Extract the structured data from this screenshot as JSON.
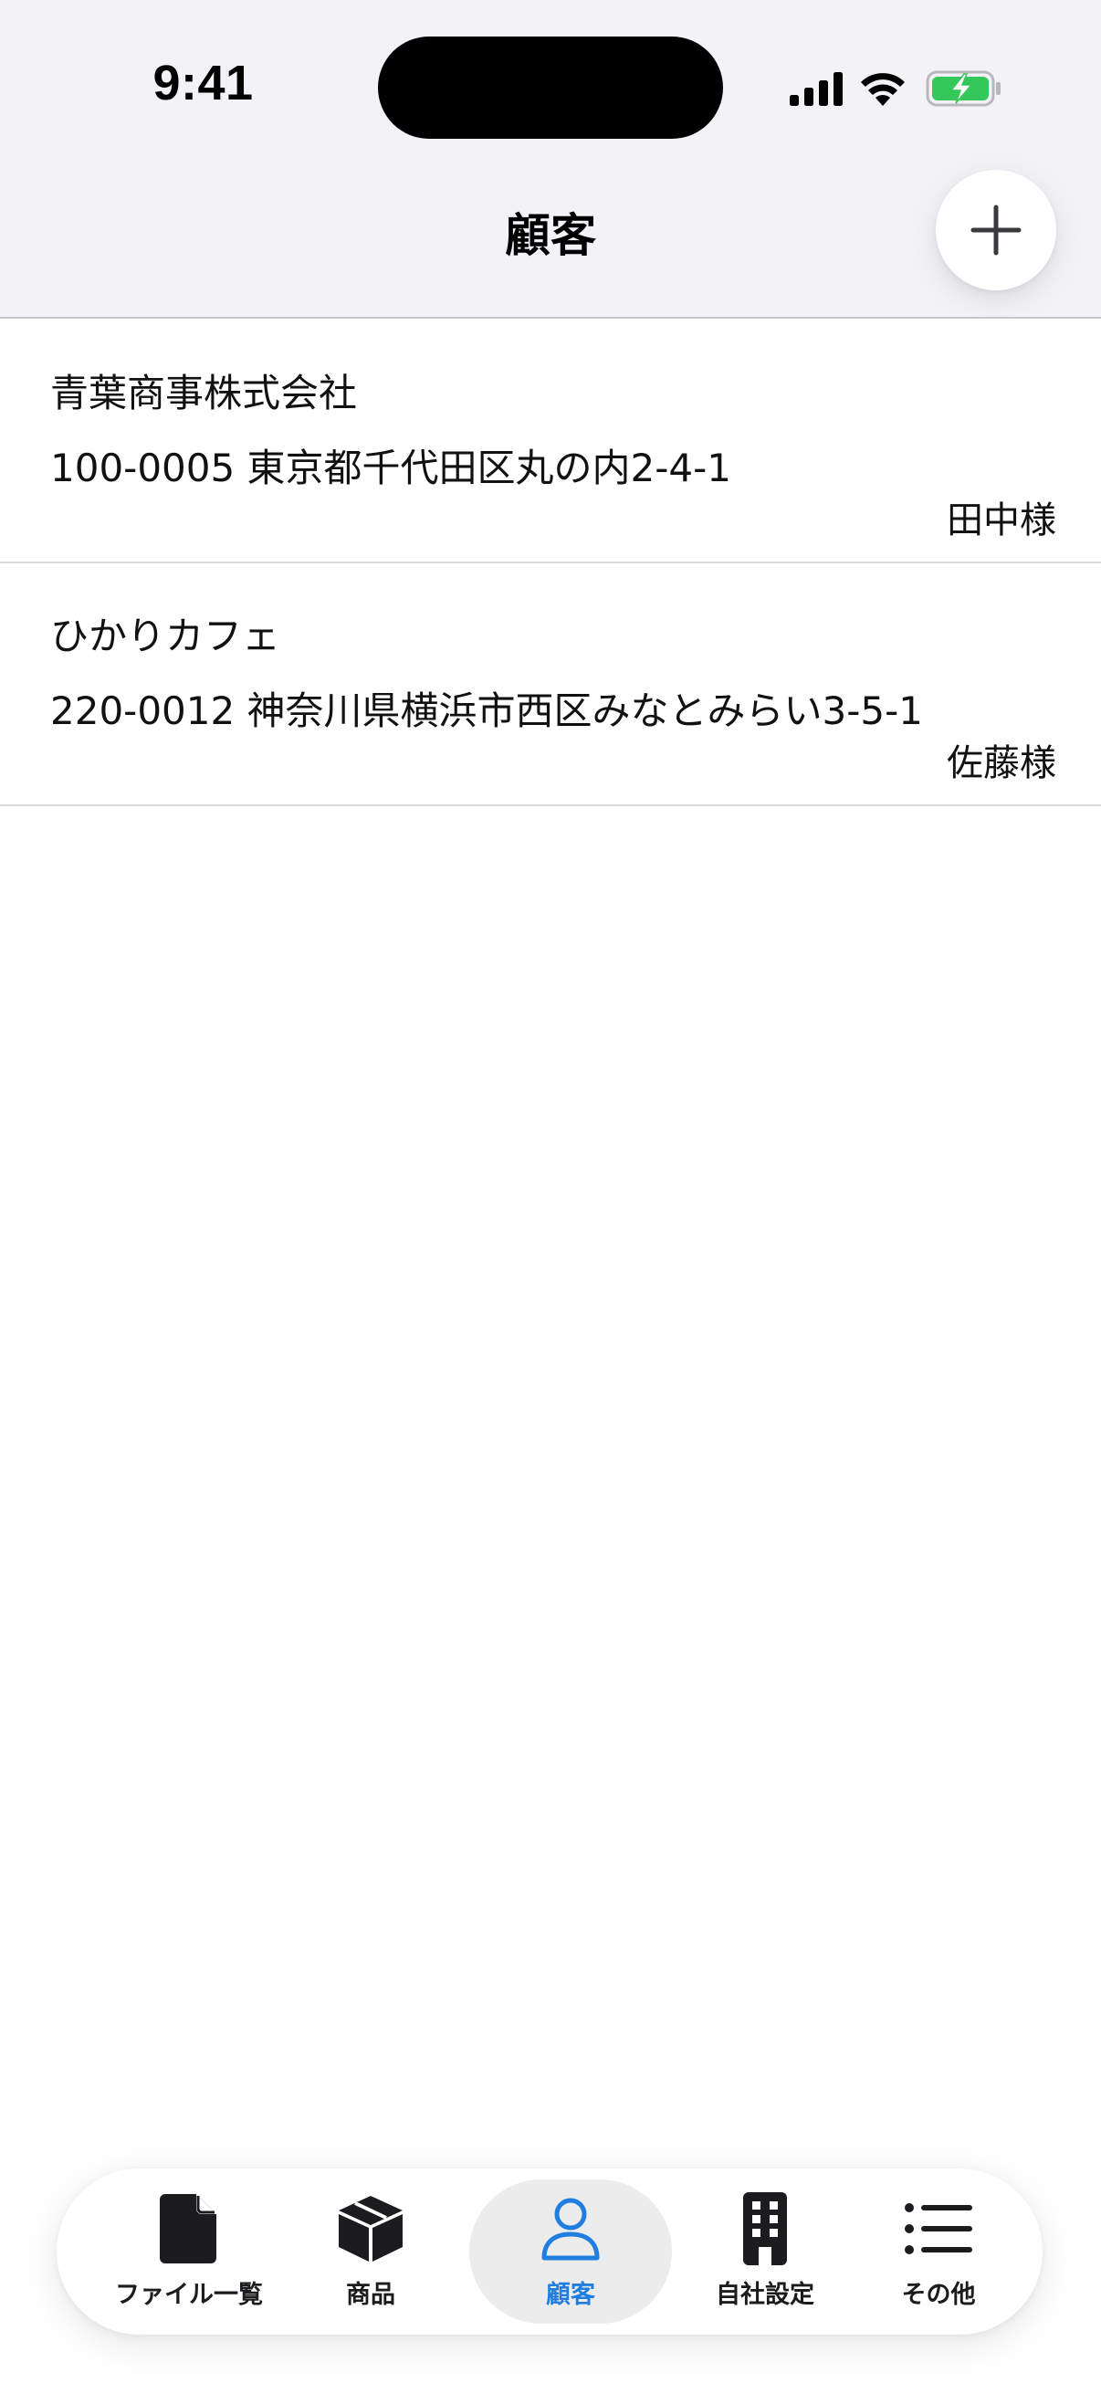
{
  "status_bar": {
    "time": "9:41"
  },
  "nav": {
    "title": "顧客",
    "add_icon": "plus-icon"
  },
  "customers": [
    {
      "name": "青葉商事株式会社",
      "address": "100-0005 東京都千代田区丸の内2-4-1",
      "contact": "田中様"
    },
    {
      "name": "ひかりカフェ",
      "address": "220-0012 神奈川県横浜市西区みなとみらい3-5-1",
      "contact": "佐藤様"
    }
  ],
  "tab_bar": {
    "items": [
      {
        "label": "ファイル一覧",
        "icon": "document-icon",
        "active": false
      },
      {
        "label": "商品",
        "icon": "box-icon",
        "active": false
      },
      {
        "label": "顧客",
        "icon": "person-icon",
        "active": true
      },
      {
        "label": "自社設定",
        "icon": "building-icon",
        "active": false
      },
      {
        "label": "その他",
        "icon": "list-icon",
        "active": false
      }
    ]
  },
  "colors": {
    "accent": "#1f7ee0",
    "header_bg": "#f2f2f7",
    "battery_green": "#34c759"
  }
}
